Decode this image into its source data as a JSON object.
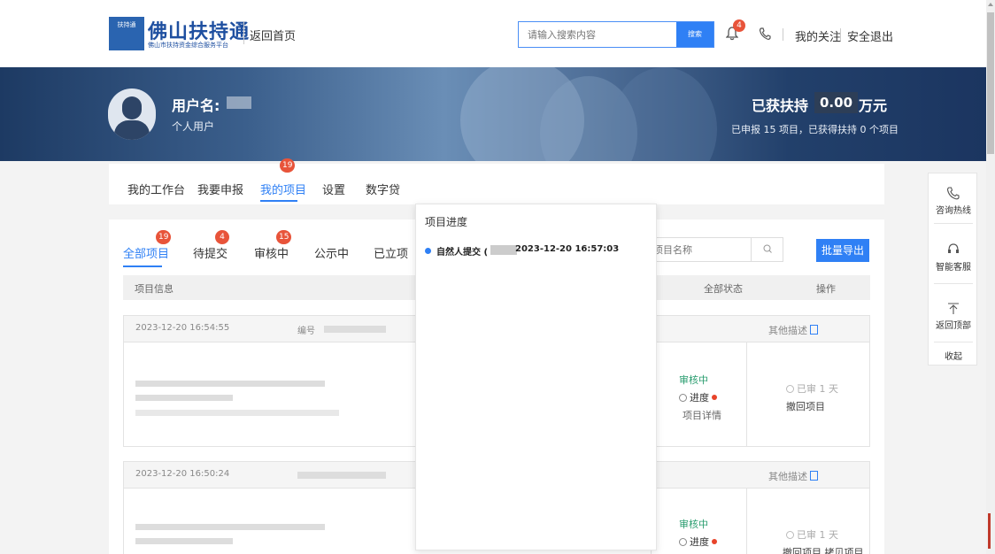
{
  "header": {
    "logo_title": "佛山扶持通",
    "logo_subtitle": "佛山市扶持资金综合服务平台",
    "logo_emblem": "扶持通",
    "home_link": "返回首页",
    "search_placeholder": "请输入搜索内容",
    "search_button": "搜索",
    "notification_count": "4",
    "my_follow": "我的关注",
    "logout": "安全退出"
  },
  "banner": {
    "user_label": "用户名:",
    "user_type": "个人用户",
    "support_title": "已获扶持",
    "support_amount": "0.00",
    "support_unit": "万元",
    "support_summary": "已申报 15 项目，已获得扶持 0 个项目"
  },
  "top_tabs": [
    {
      "label": "我的工作台"
    },
    {
      "label": "我要申报"
    },
    {
      "label": "我的项目",
      "badge": "19",
      "active": true
    },
    {
      "label": "设置"
    },
    {
      "label": "数字贷"
    }
  ],
  "sub_tabs": [
    {
      "label": "全部项目",
      "badge": "19",
      "active": true
    },
    {
      "label": "待提交",
      "badge": "4"
    },
    {
      "label": "审核中",
      "badge": "15"
    },
    {
      "label": "公示中"
    },
    {
      "label": "已立项"
    }
  ],
  "project_search_placeholder": "项目名称",
  "export_button": "批量导出",
  "table_headers": {
    "info": "项目信息",
    "status": "全部状态",
    "action": "操作"
  },
  "cards": [
    {
      "date": "2023-12-20 16:54:55",
      "code_label": "编号",
      "other_desc": "其他描述",
      "status": "审核中",
      "progress": "进度",
      "detail": "项目详情",
      "aged": "已审 1 天",
      "withdraw": "撤回项目"
    },
    {
      "date": "2023-12-20 16:50:24",
      "other_desc": "其他描述",
      "status": "审核中",
      "progress": "进度",
      "aged": "已审 1 天",
      "withdraw": "撤回项目  拷贝项目"
    }
  ],
  "popup": {
    "title": "项目进度",
    "step": "自然人提交",
    "time": "2023-12-20 16:57:03"
  },
  "side_panel": [
    {
      "label": "咨询热线",
      "icon": "phone-icon"
    },
    {
      "label": "智能客服",
      "icon": "headset-icon"
    },
    {
      "label": "返回顶部",
      "icon": "arrow-up-icon"
    },
    {
      "label": "收起"
    }
  ],
  "colors": {
    "accent": "#2f80f5",
    "badge": "#e8543a",
    "status_green": "#2a9d6f",
    "brand": "#1e4fa0"
  }
}
